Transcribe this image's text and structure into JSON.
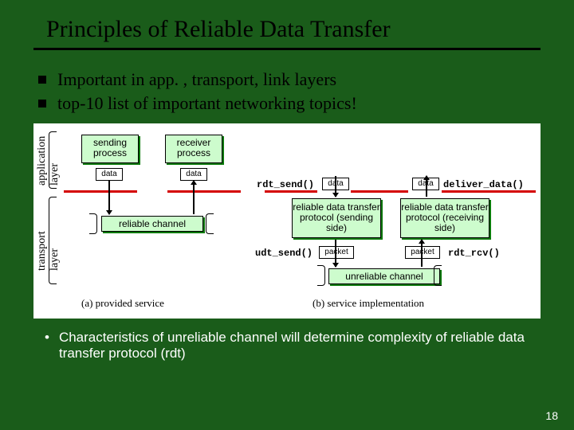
{
  "title": "Principles of Reliable Data Transfer",
  "bullets": [
    "Important in app. , transport, link layers",
    "top-10 list of important networking topics!"
  ],
  "ylabels": {
    "application": "application\nlayer",
    "transport": "transport\nlayer"
  },
  "boxes": {
    "sending_process": "sending process",
    "receiver_process": "receiver process",
    "data": "data",
    "packet": "packet",
    "reliable_channel": "reliable channel",
    "unreliable_channel": "unreliable channel",
    "proto_send": "reliable data transfer protocol (sending side)",
    "proto_recv": "reliable data transfer protocol (receiving side)"
  },
  "fns": {
    "rdt_send": "rdt_send()",
    "deliver_data": "deliver_data()",
    "udt_send": "udt_send()",
    "rdt_rcv": "rdt_rcv()"
  },
  "captions": {
    "a": "(a)  provided service",
    "b": "(b)  service implementation"
  },
  "lower": "Characteristics of unreliable channel will determine complexity of reliable data transfer protocol (rdt)",
  "page": "18"
}
